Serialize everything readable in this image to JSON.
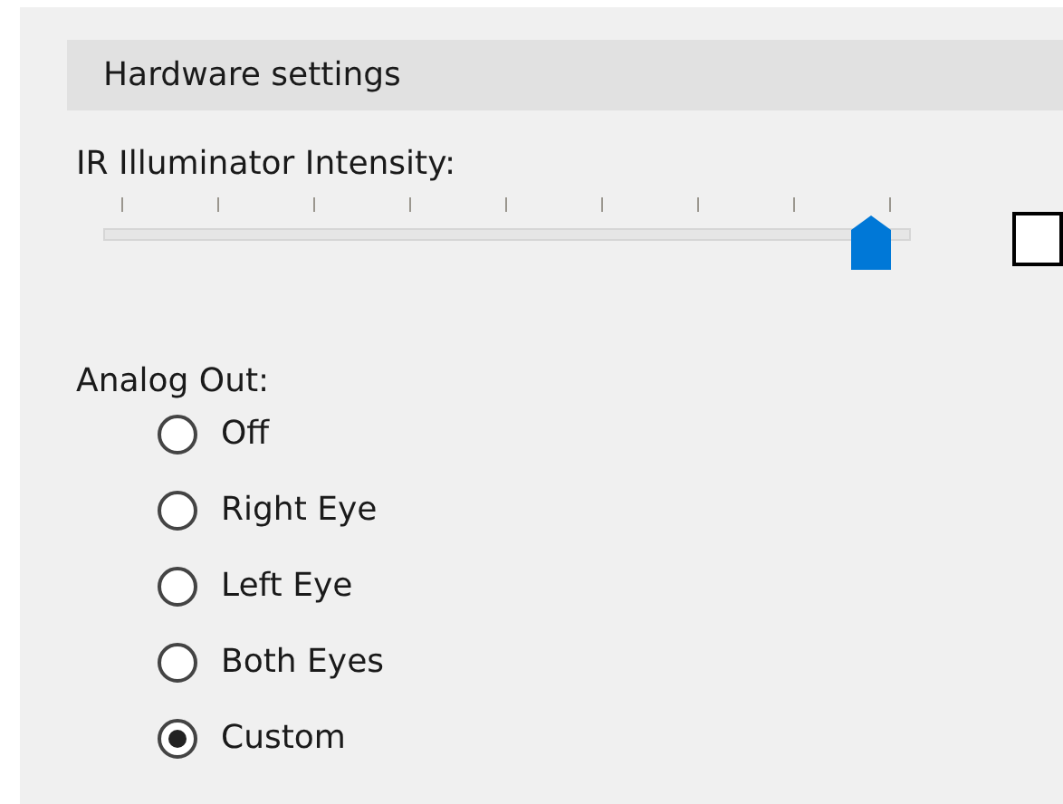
{
  "section": {
    "title": "Hardware settings"
  },
  "intensity": {
    "label": "IR Illuminator Intensity:",
    "level": 1
  },
  "analog_out": {
    "label": "Analog Out:",
    "options": [
      {
        "label": "Off",
        "selected": false
      },
      {
        "label": "Right Eye",
        "selected": false
      },
      {
        "label": "Left Eye",
        "selected": false
      },
      {
        "label": "Both Eyes",
        "selected": false
      },
      {
        "label": "Custom",
        "selected": true
      }
    ]
  }
}
